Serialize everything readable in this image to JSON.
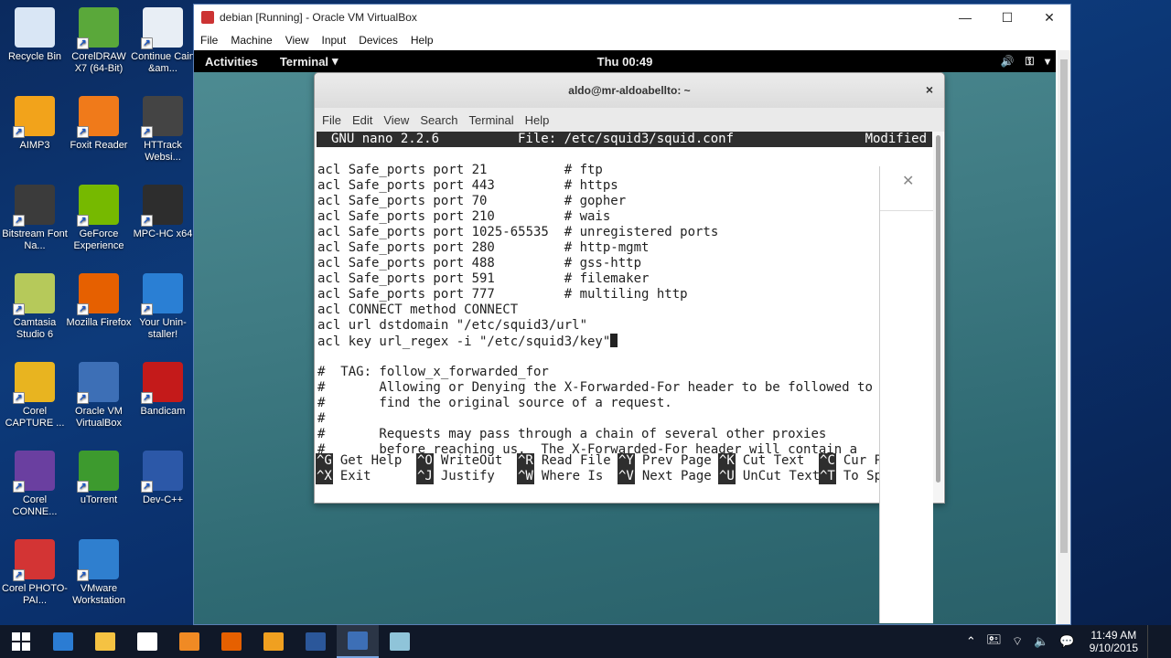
{
  "desktop": {
    "icons": [
      {
        "label": "Recycle Bin",
        "icon": "recycle-bin-icon",
        "color": "#d9e6f5"
      },
      {
        "label": "CorelDRAW X7 (64-Bit)",
        "icon": "coreldraw-icon",
        "color": "#5aa83a"
      },
      {
        "label": "Continue Cain &am...",
        "icon": "cain-icon",
        "color": "#e8eef5"
      },
      {
        "label": "AIMP3",
        "icon": "aimp-icon",
        "color": "#f2a31b"
      },
      {
        "label": "Foxit Reader",
        "icon": "foxit-icon",
        "color": "#f07a1a"
      },
      {
        "label": "HTTrack Websi...",
        "icon": "httrack-icon",
        "color": "#444444"
      },
      {
        "label": "Bitstream Font Na...",
        "icon": "bitstream-icon",
        "color": "#3b3b3b"
      },
      {
        "label": "GeForce Experience",
        "icon": "geforce-icon",
        "color": "#76b900"
      },
      {
        "label": "MPC-HC x64",
        "icon": "mpc-icon",
        "color": "#2d2d2d"
      },
      {
        "label": "Camtasia Studio 6",
        "icon": "camtasia-icon",
        "color": "#b6c95a"
      },
      {
        "label": "Mozilla Firefox",
        "icon": "firefox-icon",
        "color": "#e66000"
      },
      {
        "label": "Your Unin-staller!",
        "icon": "uninstaller-icon",
        "color": "#2a7fd4"
      },
      {
        "label": "Corel CAPTURE ...",
        "icon": "corel-capture-icon",
        "color": "#e8b420"
      },
      {
        "label": "Oracle VM VirtualBox",
        "icon": "virtualbox-icon",
        "color": "#3d6fb6"
      },
      {
        "label": "Bandicam",
        "icon": "bandicam-icon",
        "color": "#c41a1a"
      },
      {
        "label": "Corel CONNE...",
        "icon": "corel-connect-icon",
        "color": "#6a3fa0"
      },
      {
        "label": "uTorrent",
        "icon": "utorrent-icon",
        "color": "#3d9a2e"
      },
      {
        "label": "Dev-C++",
        "icon": "devcpp-icon",
        "color": "#2c58a8"
      },
      {
        "label": "Corel PHOTO-PAI...",
        "icon": "corel-photopaint-icon",
        "color": "#d33434"
      },
      {
        "label": "VMware Workstation",
        "icon": "vmware-icon",
        "color": "#2f7fcf"
      }
    ]
  },
  "vbox": {
    "title": "debian [Running] - Oracle VM VirtualBox",
    "menu": [
      "File",
      "Machine",
      "View",
      "Input",
      "Devices",
      "Help"
    ],
    "minimize": "—",
    "maximize": "☐",
    "close": "✕"
  },
  "gnome": {
    "activities": "Activities",
    "app_menu": "Terminal",
    "clock": "Thu 00:49",
    "tray": [
      "🔊",
      "⚿",
      "▾"
    ]
  },
  "terminal": {
    "title": "aldo@mr-aldoabellto: ~",
    "close": "×",
    "menu": [
      "File",
      "Edit",
      "View",
      "Search",
      "Terminal",
      "Help"
    ],
    "nano": {
      "version": "GNU nano 2.2.6",
      "file": "File: /etc/squid3/squid.conf",
      "status": "Modified",
      "lines": [
        "acl Safe_ports port 21          # ftp",
        "acl Safe_ports port 443         # https",
        "acl Safe_ports port 70          # gopher",
        "acl Safe_ports port 210         # wais",
        "acl Safe_ports port 1025-65535  # unregistered ports",
        "acl Safe_ports port 280         # http-mgmt",
        "acl Safe_ports port 488         # gss-http",
        "acl Safe_ports port 591         # filemaker",
        "acl Safe_ports port 777         # multiling http",
        "acl CONNECT method CONNECT",
        "acl url dstdomain \"/etc/squid3/url\"",
        "acl key url_regex -i \"/etc/squid3/key\"",
        "",
        "#  TAG: follow_x_forwarded_for",
        "#       Allowing or Denying the X-Forwarded-For header to be followed to",
        "#       find the original source of a request.",
        "#",
        "#       Requests may pass through a chain of several other proxies",
        "#       before reaching us.  The X-Forwarded-For header will contain a"
      ],
      "shortcuts_row1": [
        {
          "key": "^G",
          "label": "Get Help"
        },
        {
          "key": "^O",
          "label": "WriteOut"
        },
        {
          "key": "^R",
          "label": "Read File"
        },
        {
          "key": "^Y",
          "label": "Prev Page"
        },
        {
          "key": "^K",
          "label": "Cut Text"
        },
        {
          "key": "^C",
          "label": "Cur Pos"
        }
      ],
      "shortcuts_row2": [
        {
          "key": "^X",
          "label": "Exit"
        },
        {
          "key": "^J",
          "label": "Justify"
        },
        {
          "key": "^W",
          "label": "Where Is"
        },
        {
          "key": "^V",
          "label": "Next Page"
        },
        {
          "key": "^U",
          "label": "UnCut Text"
        },
        {
          "key": "^T",
          "label": "To Spell"
        }
      ]
    }
  },
  "taskbar": {
    "apps": [
      {
        "name": "start-button",
        "color": "#ffffff"
      },
      {
        "name": "edge-icon",
        "color": "#2b7cd3"
      },
      {
        "name": "file-explorer-icon",
        "color": "#f5c242"
      },
      {
        "name": "store-icon",
        "color": "#ffffff"
      },
      {
        "name": "media-player-icon",
        "color": "#f08a24"
      },
      {
        "name": "firefox-icon",
        "color": "#e66000"
      },
      {
        "name": "vlc-icon",
        "color": "#f0a020"
      },
      {
        "name": "word-icon",
        "color": "#2b579a"
      },
      {
        "name": "virtualbox-icon",
        "color": "#3d6fb6"
      },
      {
        "name": "camtasia-icon",
        "color": "#8fc4d9"
      }
    ],
    "tray_icons": [
      "⌃",
      "🖭",
      "⌔",
      "🔈",
      "💬"
    ],
    "time": "11:49 AM",
    "date": "9/10/2015"
  }
}
